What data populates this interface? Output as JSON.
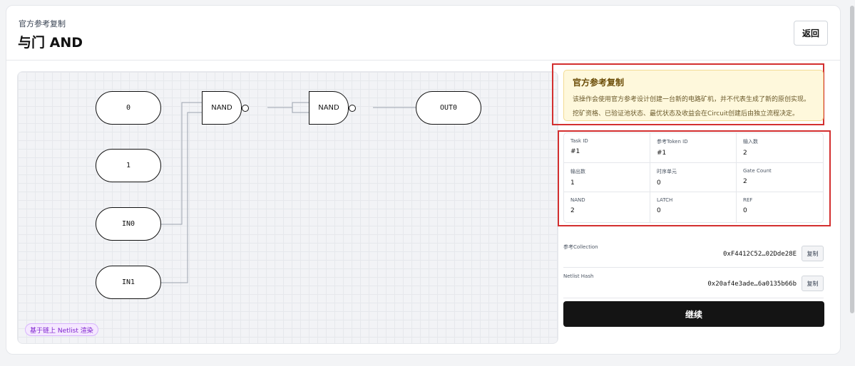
{
  "header": {
    "kicker": "官方参考复制",
    "title": "与门 AND",
    "back_label": "返回"
  },
  "canvas": {
    "nodes": {
      "in_0": "0",
      "in_1": "1",
      "in_in0": "IN0",
      "in_in1": "IN1",
      "gate_1": "NAND",
      "gate_2": "NAND",
      "out": "OUT0"
    },
    "badge": "基于链上 Netlist 渲染"
  },
  "notice": {
    "title": "官方参考复制",
    "line1": "该操作会使用官方参考设计创建一台新的电路矿机，并不代表生成了新的原创实现。",
    "line2": "挖矿资格、已验证池状态、最优状态及收益会在Circuit创建后由独立流程决定。"
  },
  "stats": [
    {
      "label": "Task ID",
      "value": "#1"
    },
    {
      "label": "参考Token ID",
      "value": "#1"
    },
    {
      "label": "输入数",
      "value": "2"
    },
    {
      "label": "输出数",
      "value": "1"
    },
    {
      "label": "时序单元",
      "value": "0"
    },
    {
      "label": "Gate Count",
      "value": "2"
    },
    {
      "label": "NAND",
      "value": "2"
    },
    {
      "label": "LATCH",
      "value": "0"
    },
    {
      "label": "REF",
      "value": "0"
    }
  ],
  "collection": {
    "label": "参考Collection",
    "value": "0xF4412C52…02Dde28E",
    "copy_label": "复制"
  },
  "netlist": {
    "label": "Netlist Hash",
    "value": "0x20af4e3ade…6a0135b66b",
    "copy_label": "复制"
  },
  "continue_label": "继续"
}
